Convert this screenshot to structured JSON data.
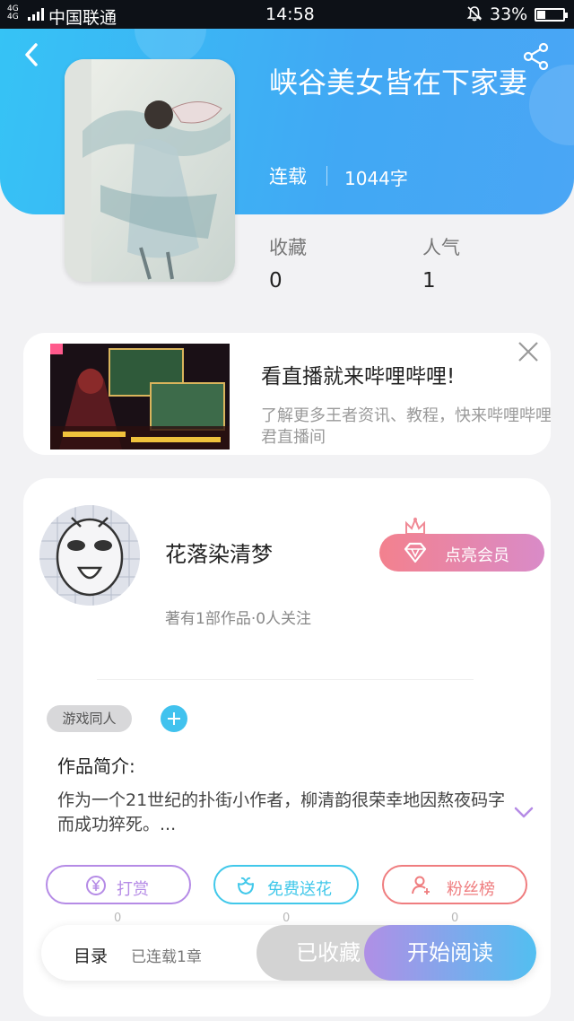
{
  "status_bar": {
    "network": "4G",
    "carrier": "中国联通",
    "time": "14:58",
    "battery": "33%",
    "battery_level": 0.33
  },
  "book": {
    "title": "峡谷美女皆在下家妻",
    "status": "连载",
    "word_count": "1044字"
  },
  "stats": [
    {
      "label": "收藏",
      "value": "0"
    },
    {
      "label": "人气",
      "value": "1"
    }
  ],
  "ad": {
    "title": "看直播就来哔哩哔哩!",
    "description": "了解更多王者资讯、教程，快来哔哩哔哩进入黑哲君直播间"
  },
  "author": {
    "name": "花落染清梦",
    "meta": "著有1部作品·0人关注",
    "vip_label": "点亮会员"
  },
  "tags": {
    "items": [
      "游戏同人"
    ]
  },
  "intro": {
    "heading": "作品简介:",
    "text": "作为一个21世纪的扑街小作者，柳清韵很荣幸地因熬夜码字而成功猝死。..."
  },
  "actions": [
    {
      "label": "打赏",
      "count": "0",
      "color": "#b58be6",
      "icon": "yen-coin-icon"
    },
    {
      "label": "免费送花",
      "count": "0",
      "color": "#41c8ea",
      "icon": "flower-icon"
    },
    {
      "label": "粉丝榜",
      "count": "0",
      "color": "#ef7d7f",
      "icon": "fan-user-icon"
    }
  ],
  "bottom_bar": {
    "toc": "目录",
    "chapters": "已连载1章",
    "favorited": "已收藏",
    "start_reading": "开始阅读"
  },
  "colors": {
    "header_blue": "#3db8f5",
    "vip_gradient_start": "#f3818e",
    "read_gradient_start": "#b08fe6",
    "read_gradient_end": "#52bff1"
  }
}
